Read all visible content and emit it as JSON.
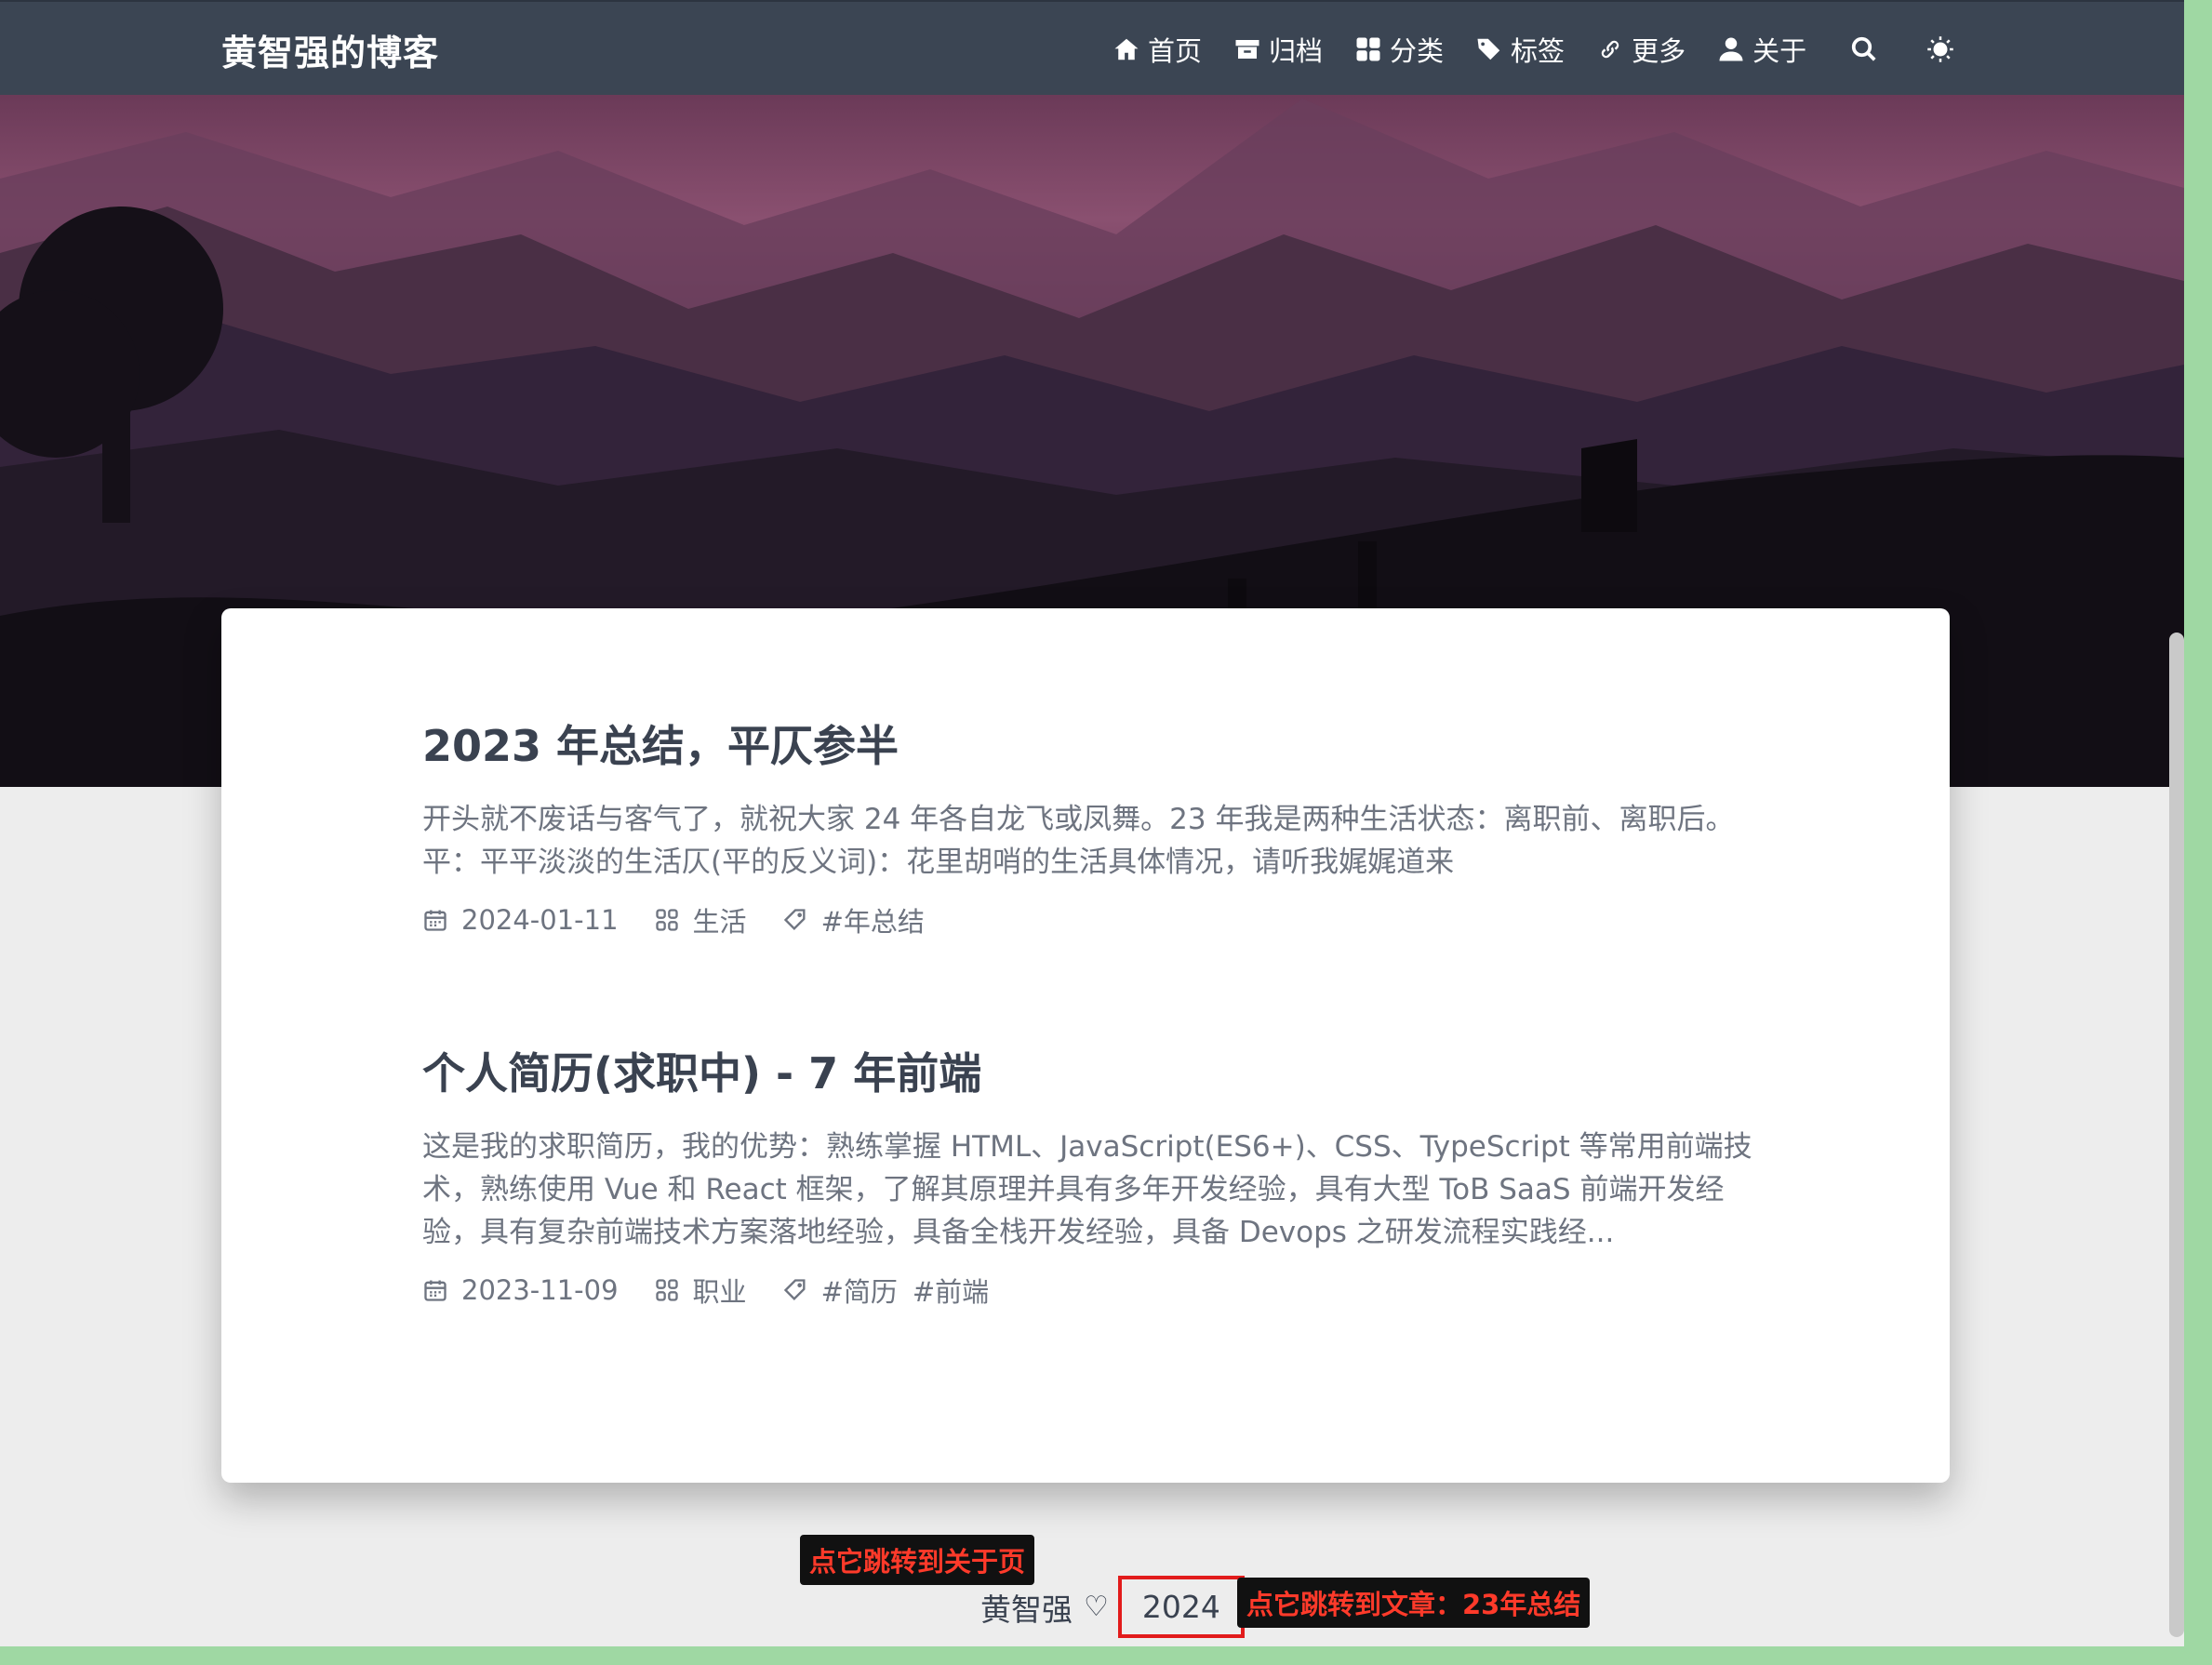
{
  "header": {
    "brand": "黄智强的博客",
    "nav": [
      {
        "label": "首页",
        "icon": "home-icon"
      },
      {
        "label": "归档",
        "icon": "archive-icon"
      },
      {
        "label": "分类",
        "icon": "grid-icon"
      },
      {
        "label": "标签",
        "icon": "tags-icon"
      },
      {
        "label": "更多",
        "icon": "link-icon"
      },
      {
        "label": "关于",
        "icon": "user-icon"
      }
    ],
    "search_icon": "search-icon",
    "theme_icon": "sun-icon"
  },
  "posts": [
    {
      "title": "2023 年总结，平仄参半",
      "excerpt": "开头就不废话与客气了，就祝大家 24 年各自龙飞或凤舞。23 年我是两种生活状态：离职前、离职后。平：平平淡淡的生活仄(平的反义词)：花里胡哨的生活具体情况，请听我娓娓道来",
      "date": "2024-01-11",
      "category": "生活",
      "tags": [
        "#年总结"
      ]
    },
    {
      "title": "个人简历(求职中) - 7 年前端",
      "excerpt": "这是我的求职简历，我的优势：熟练掌握 HTML、JavaScript(ES6+)、CSS、TypeScript 等常用前端技术，熟练使用 Vue 和 React 框架，了解其原理并具有多年开发经验，具有大型 ToB SaaS 前端开发经验，具有复杂前端技术方案落地经验，具备全栈开发经验，具备 Devops 之研发流程实践经...",
      "date": "2023-11-09",
      "category": "职业",
      "tags": [
        "#简历",
        "#前端"
      ]
    }
  ],
  "footer": {
    "author": "黄智强",
    "heart": "♡",
    "year": "2024"
  },
  "annotations": {
    "about": "点它跳转到关于页",
    "article": "点它跳转到文章：23年总结"
  },
  "colors": {
    "navbar": "#3b4553",
    "annotation_bg": "#111111",
    "annotation_text": "#ff3a2a",
    "highlight_box": "#e21b1b"
  }
}
